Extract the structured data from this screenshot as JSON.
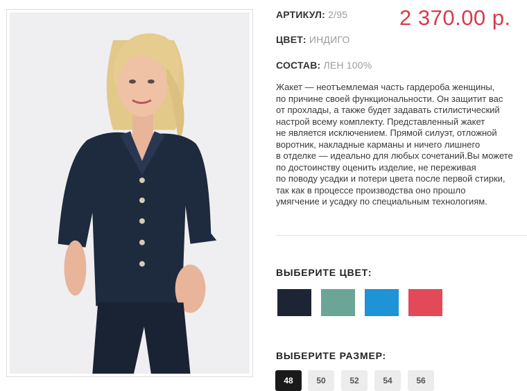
{
  "product": {
    "sku_label": "АРТИКУЛ:",
    "sku_value": "2/95",
    "color_label": "ЦВЕТ:",
    "color_value": "ИНДИГО",
    "composition_label": "СОСТАВ:",
    "composition_value": "ЛЕН 100%",
    "price": "2 370.00 р.",
    "description_lines": [
      "Жакет — неотъемлемая часть гардероба женщины,",
      "по причине своей функциональности. Он защитит вас",
      "от прохлады, а также будет задавать стилистический",
      "настрой всему комплекту. Представленный жакет",
      "не является исключением. Прямой силуэт, отложной",
      "воротник, накладные карманы и ничего лишнего",
      "в отделке — идеально для любых сочетаний.Вы можете",
      "по достоинству оценить изделие, не переживая",
      "по поводу усадки и потери цвета после первой стирки,",
      "так как в процессе производства оно прошло",
      "умягчение и усадку по специальным технологиям."
    ]
  },
  "choose_color": {
    "title": "ВЫБЕРИТЕ ЦВЕТ:",
    "swatches": [
      {
        "name": "indigo",
        "color": "#1d2535"
      },
      {
        "name": "sea-green",
        "color": "#6aa596"
      },
      {
        "name": "blue",
        "color": "#1e93d6"
      },
      {
        "name": "coral",
        "color": "#e34a58"
      }
    ]
  },
  "choose_size": {
    "title": "ВЫБЕРИТЕ РАЗМЕР:",
    "sizes": [
      "48",
      "50",
      "52",
      "54",
      "56"
    ],
    "selected_index": 0
  },
  "colors": {
    "price": "#d93a4a",
    "photo_bg": "#efeff1"
  }
}
